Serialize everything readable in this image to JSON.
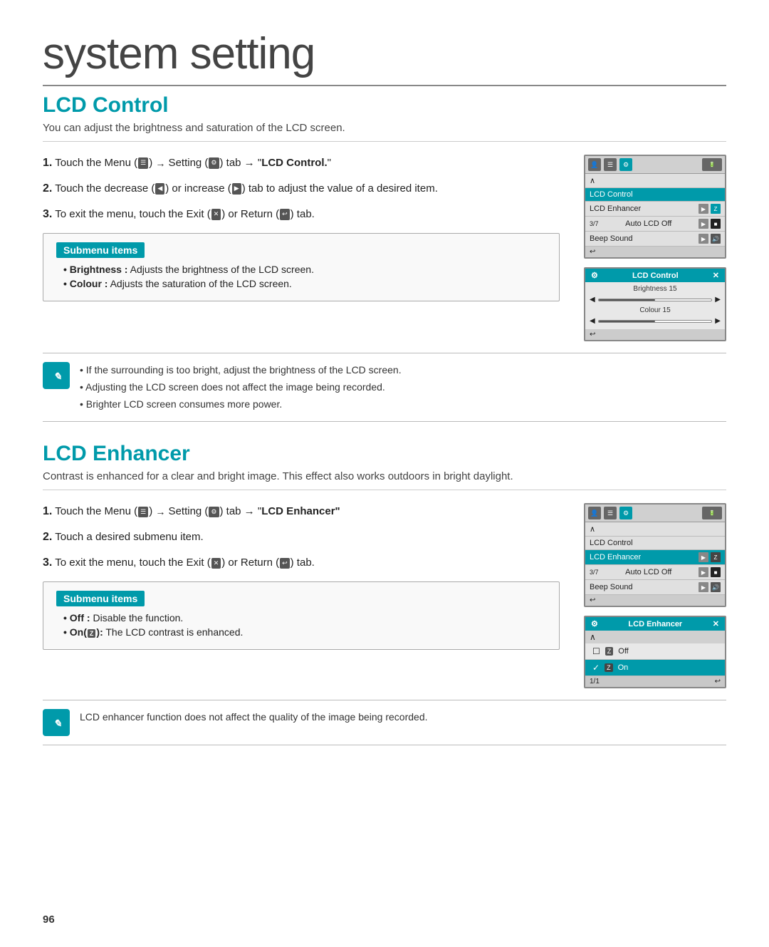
{
  "page": {
    "title": "system setting",
    "page_number": "96"
  },
  "lcd_control": {
    "heading": "LCD Control",
    "description": "You can adjust the brightness and saturation of the LCD screen.",
    "steps": [
      {
        "num": "1.",
        "text_before": "Touch the Menu (",
        "icon1": "menu-icon",
        "text_mid1": ") → Setting (",
        "icon2": "settings-icon",
        "text_mid2": ") tab → \"",
        "bold": "LCD Control.",
        "text_after": "\""
      },
      {
        "num": "2.",
        "text": "Touch the decrease (",
        "icon1": "decrease-icon",
        "text_mid": ") or increase (",
        "icon2": "increase-icon",
        "text_end": ") tab to adjust the value of a desired item."
      },
      {
        "num": "3.",
        "text": "To exit the menu, touch the Exit (",
        "icon1": "exit-icon",
        "text_mid": ") or Return (",
        "icon2": "return-icon",
        "text_end": ") tab."
      }
    ],
    "submenu": {
      "title": "Submenu items",
      "items": [
        {
          "bold": "Brightness :",
          "text": " Adjusts the brightness of the LCD screen."
        },
        {
          "bold": "Colour :",
          "text": " Adjusts the saturation of the LCD screen."
        }
      ]
    },
    "notes": [
      "If the surrounding is too bright, adjust the brightness of the LCD screen.",
      "Adjusting the LCD screen does not affect the image being recorded.",
      "Brighter LCD screen consumes more power."
    ],
    "mockup1": {
      "header_icons": [
        "person-icon",
        "menu-icon",
        "settings-icon",
        "battery-icon"
      ],
      "rows": [
        {
          "label": "LCD Control",
          "selected": true
        },
        {
          "label": "LCD Enhancer",
          "icons": [
            "play-icon",
            "enhance-icon"
          ]
        },
        {
          "label": "Auto LCD Off",
          "nav": "3/7",
          "icons": [
            "play-icon",
            "black-icon"
          ]
        },
        {
          "label": "Beep Sound",
          "icons": [
            "play-icon",
            "sound-icon"
          ]
        }
      ]
    },
    "mockup2": {
      "header": "LCD Control",
      "brightness_label": "Brightness 15",
      "brightness_value": 50,
      "colour_label": "Colour 15",
      "colour_value": 50
    }
  },
  "lcd_enhancer": {
    "heading": "LCD Enhancer",
    "description": "Contrast is enhanced for a clear and bright image. This effect also works outdoors in bright daylight.",
    "steps": [
      {
        "num": "1.",
        "text_before": "Touch the Menu (",
        "icon1": "menu-icon",
        "text_mid1": ") → Setting (",
        "icon2": "settings-icon",
        "text_mid2": ") tab → \"",
        "bold": "LCD Enhancer\"",
        "text_after": ""
      },
      {
        "num": "2.",
        "text": "Touch a desired submenu item."
      },
      {
        "num": "3.",
        "text": "To exit the menu, touch the Exit (",
        "icon1": "exit-icon",
        "text_mid": ") or Return (",
        "icon2": "return-icon",
        "text_end": ") tab."
      }
    ],
    "submenu": {
      "title": "Submenu items",
      "items": [
        {
          "bold": "Off :",
          "text": " Disable the function."
        },
        {
          "bold": "On(",
          "icon": "enhance-icon",
          "bold2": "):",
          "text": " The LCD contrast is enhanced."
        }
      ]
    },
    "note": "LCD enhancer function does not affect the quality of the image being recorded.",
    "mockup1": {
      "header_icons": [
        "person-icon",
        "menu-icon",
        "settings-icon",
        "battery-icon"
      ],
      "rows": [
        {
          "label": "LCD Control"
        },
        {
          "label": "LCD Enhancer",
          "selected": true,
          "icons": [
            "play-icon",
            "enhance-icon"
          ]
        },
        {
          "label": "Auto LCD Off",
          "nav": "3/7",
          "icons": [
            "play-icon",
            "black-icon"
          ]
        },
        {
          "label": "Beep Sound",
          "icons": [
            "play-icon",
            "sound-icon"
          ]
        }
      ]
    },
    "mockup2": {
      "header": "LCD Enhancer",
      "nav": "1/1",
      "items": [
        {
          "label": "Off",
          "checked": false,
          "icon": "enhance-icon"
        },
        {
          "label": "On",
          "checked": true,
          "icon": "enhance-icon",
          "selected": true
        }
      ]
    }
  },
  "ui": {
    "beep_sound_label": "Beep Sound",
    "auto_lcd_off": "Auto LCD Off",
    "lcd_control": "LCD Control",
    "lcd_enhancer": "LCD Enhancer",
    "brightness": "Brightness 15",
    "colour": "Colour 15",
    "off_label": "Off",
    "on_label": "On",
    "submenu_title": "Submenu items",
    "close_x": "✕",
    "back_arrow": "↩",
    "play_triangle": "▶",
    "left_arrow": "◀",
    "right_arrow": "▶",
    "up_caret": "∧",
    "down_caret": "∨"
  }
}
